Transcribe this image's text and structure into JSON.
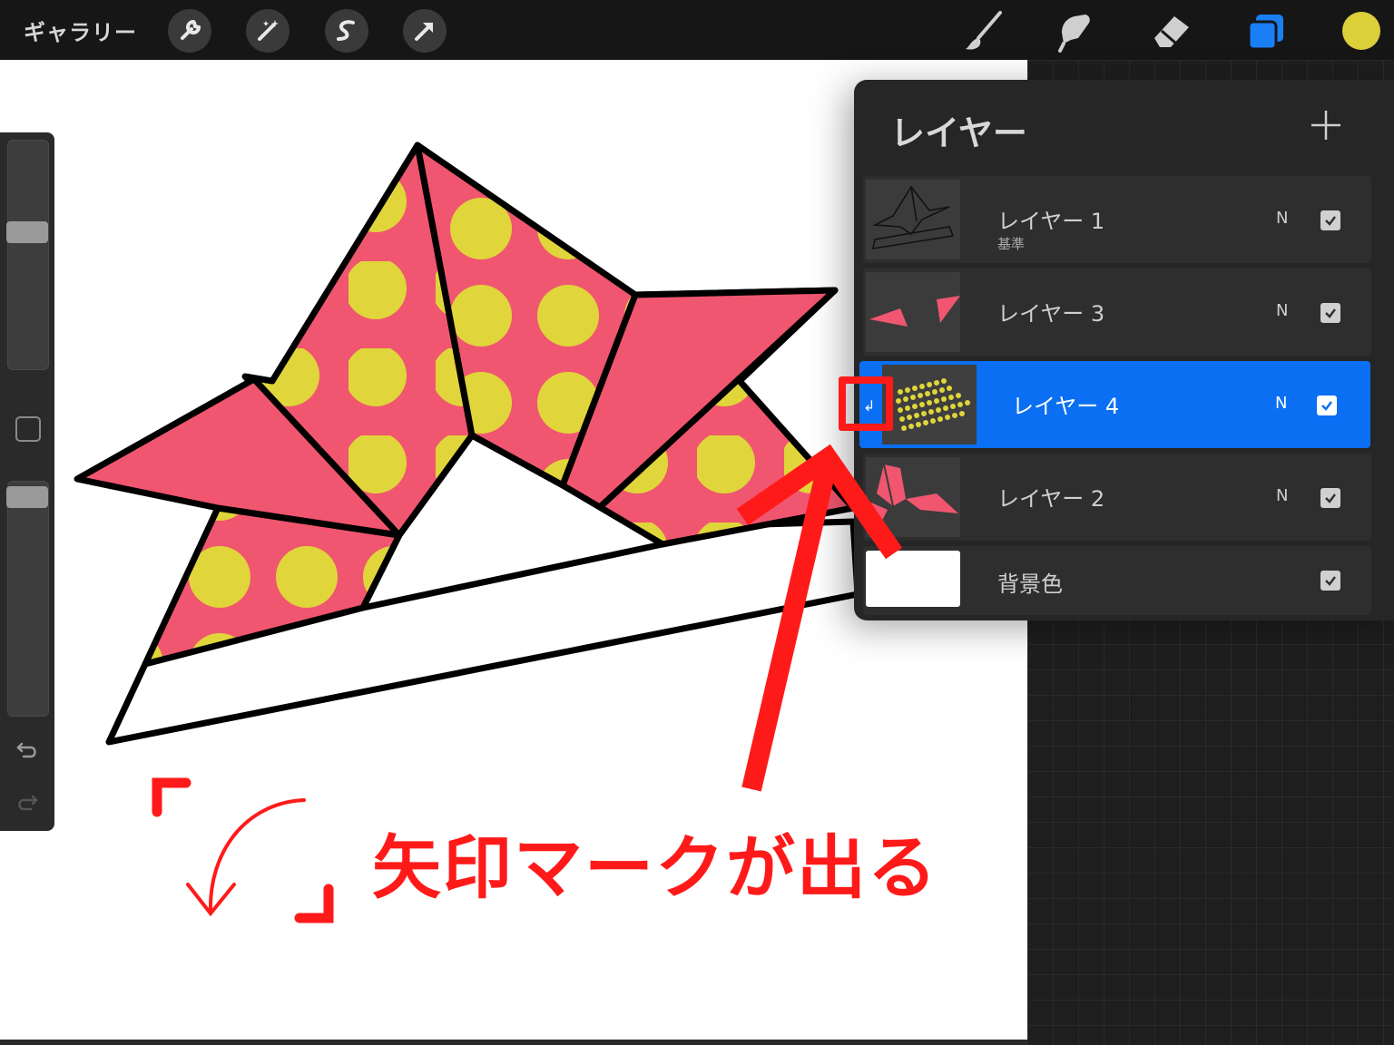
{
  "toolbar": {
    "gallery_label": "ギャラリー",
    "left_tools": [
      "wrench-icon",
      "magic-wand-icon",
      "selection-icon",
      "move-arrow-icon"
    ],
    "right_tools": [
      "brush-icon",
      "smudge-icon",
      "eraser-icon",
      "layers-icon"
    ],
    "current_color": "#dcd03a",
    "layers_active_color": "#1a7ff5"
  },
  "layers_panel": {
    "title": "レイヤー",
    "add_icon": "plus-icon",
    "layers": [
      {
        "name": "レイヤー 1",
        "sub": "基準",
        "blend": "N",
        "visible": true,
        "selected": false
      },
      {
        "name": "レイヤー 3",
        "sub": "",
        "blend": "N",
        "visible": true,
        "selected": false
      },
      {
        "name": "レイヤー 4",
        "sub": "",
        "blend": "N",
        "visible": true,
        "selected": true,
        "clipping_icon": "↲"
      },
      {
        "name": "レイヤー 2",
        "sub": "",
        "blend": "N",
        "visible": true,
        "selected": false
      },
      {
        "name": "背景色",
        "sub": "",
        "blend": "",
        "visible": true,
        "selected": false
      }
    ],
    "selected_color": "#0a6ff2"
  },
  "annotation": {
    "text": "矢印マークが出る",
    "color": "#ff1a1a"
  },
  "sidebar": {
    "size_slider_level": 0.55,
    "opacity_slider_level": 0.95,
    "icons": [
      "modify-square-icon",
      "undo-icon",
      "redo-icon"
    ]
  },
  "illustration": {
    "pink": "#f0566f",
    "dot_yellow": "#e0d53a"
  }
}
